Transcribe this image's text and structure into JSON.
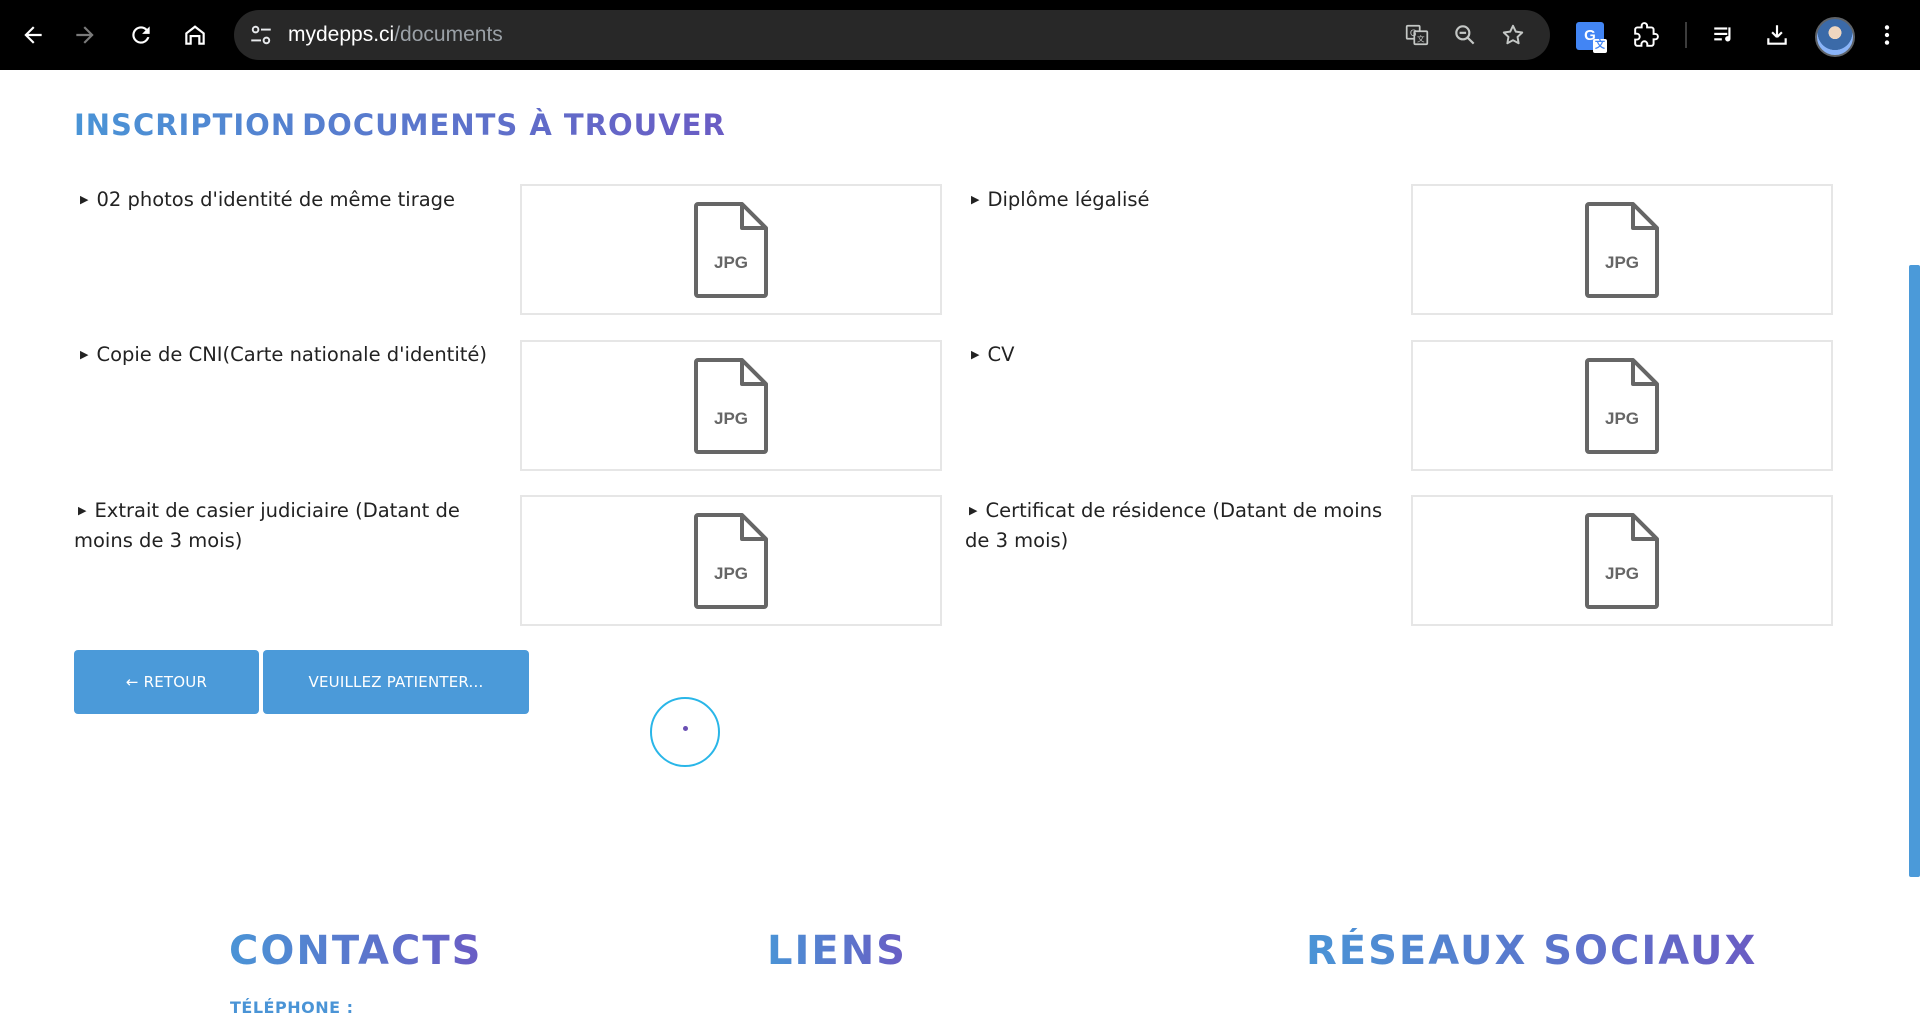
{
  "browser": {
    "url_domain": "mydepps.ci",
    "url_path": "/documents",
    "icons": {
      "back": "back-arrow-icon",
      "forward": "forward-arrow-icon",
      "reload": "reload-icon",
      "home": "home-icon",
      "site_info": "tune-icon",
      "translate": "translate-icon",
      "zoom": "zoom-out-icon",
      "bookmark": "star-icon",
      "google_translate_ext": "google-translate-extension-icon",
      "extensions": "puzzle-icon",
      "media": "media-queue-icon",
      "downloads": "download-icon",
      "profile": "avatar",
      "menu": "kebab-menu-icon"
    },
    "translate_ext_glyph": "G",
    "translate_ext_sub": "文"
  },
  "page": {
    "title_part1": "INSCRIPTION",
    "title_part2": "DOCUMENTS À TROUVER",
    "documents": [
      {
        "label": "02 photos d'identité de même tirage",
        "file_type": "JPG"
      },
      {
        "label": "Diplôme légalisé",
        "file_type": "JPG"
      },
      {
        "label": "Copie de CNI(Carte nationale d'identité)",
        "file_type": "JPG"
      },
      {
        "label": "CV",
        "file_type": "JPG"
      },
      {
        "label": "Extrait de casier judiciaire (Datant de moins de 3 mois)",
        "file_type": "JPG"
      },
      {
        "label": "Certificat de résidence (Datant de moins de 3 mois)",
        "file_type": "JPG"
      }
    ],
    "back_button": "← RETOUR",
    "submit_button": "VEUILLEZ PATIENTER..."
  },
  "footer": {
    "contacts_heading": "CONTACTS",
    "links_heading": "LIENS",
    "social_heading": "RÉSEAUX SOCIAUX",
    "telephone_label": "TÉLÉPHONE :"
  },
  "colors": {
    "accent_blue": "#4b9ad9",
    "gradient_start": "#4a94d6",
    "gradient_end": "#6a5cc4",
    "spinner_ring": "#29b6e8"
  }
}
